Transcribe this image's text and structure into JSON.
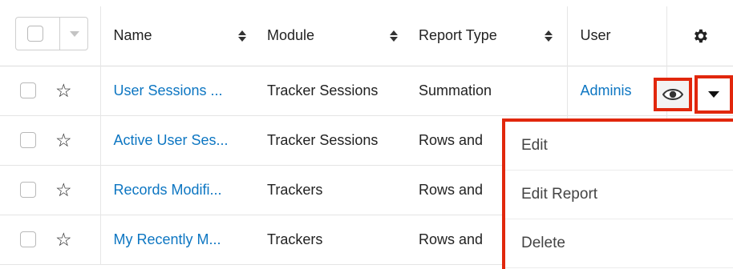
{
  "header": {
    "columns": [
      {
        "label": "Name"
      },
      {
        "label": "Module"
      },
      {
        "label": "Report Type"
      },
      {
        "label": "User"
      }
    ]
  },
  "rows": [
    {
      "name": "User Sessions ...",
      "module": "Tracker Sessions",
      "report_type": "Summation",
      "user": "Adminis"
    },
    {
      "name": "Active User Ses...",
      "module": "Tracker Sessions",
      "report_type": "Rows and",
      "user": ""
    },
    {
      "name": "Records Modifi...",
      "module": "Trackers",
      "report_type": "Rows and",
      "user": ""
    },
    {
      "name": "My Recently M...",
      "module": "Trackers",
      "report_type": "Rows and",
      "user": ""
    }
  ],
  "row_actions_menu": {
    "items": [
      {
        "label": "Edit"
      },
      {
        "label": "Edit Report"
      },
      {
        "label": "Delete"
      }
    ]
  },
  "colors": {
    "link": "#0d76c2",
    "highlight": "#e1270c"
  }
}
